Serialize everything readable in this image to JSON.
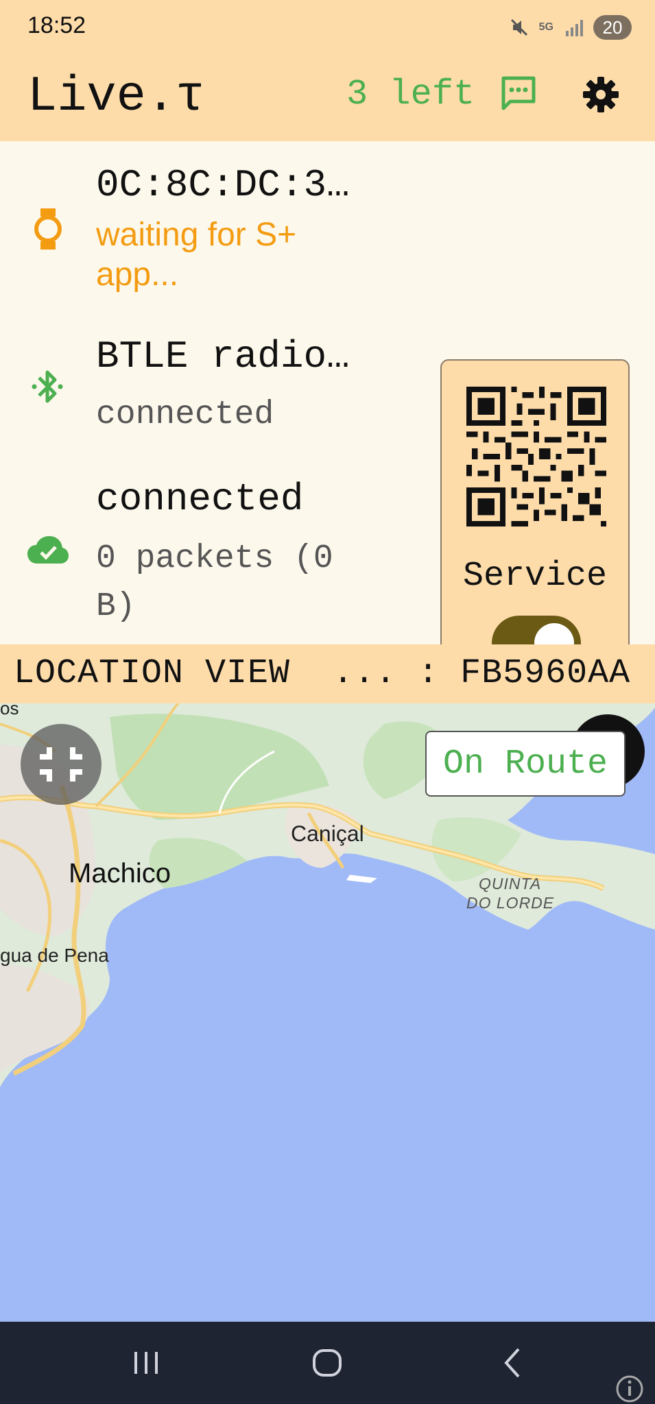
{
  "status_bar": {
    "time": "18:52",
    "network": "5G",
    "battery": "20",
    "icons": [
      "mute-icon",
      "network-5g-icon",
      "signal-icon",
      "battery-icon"
    ]
  },
  "app_bar": {
    "title": "Live.τ",
    "left_count": "3 left",
    "message_icon": "message-icon",
    "settings_icon": "gear-icon"
  },
  "status_panel": {
    "watch": {
      "icon": "watch-icon",
      "title": "0C:8C:DC:3…",
      "status": "waiting for S+ app..."
    },
    "radio": {
      "icon": "bluetooth-icon",
      "title": "BTLE radio…",
      "status": "connected"
    },
    "cloud": {
      "icon": "cloud-done-icon",
      "title": "connected",
      "status": "0 packets (0 B)"
    },
    "service": {
      "label": "Service",
      "toggle_on": true
    }
  },
  "location": {
    "header": "LOCATION VIEW  ... : FB5960AA",
    "route_button": "On Route",
    "map_labels": {
      "top_cut": "os",
      "canical": "Caniçal",
      "machico": "Machico",
      "agua_de_pena": "gua de Pena",
      "quinta_line1": "QUINTA",
      "quinta_line2": "DO LORDE"
    }
  },
  "colors": {
    "header_bg": "#fddcaa",
    "panel_bg": "#fdf8ec",
    "accent_green": "#4caf50",
    "warning_orange": "#f39c12",
    "toggle_on": "#6b5a14",
    "water": "#a0baf7",
    "navbar": "#1f2433"
  }
}
